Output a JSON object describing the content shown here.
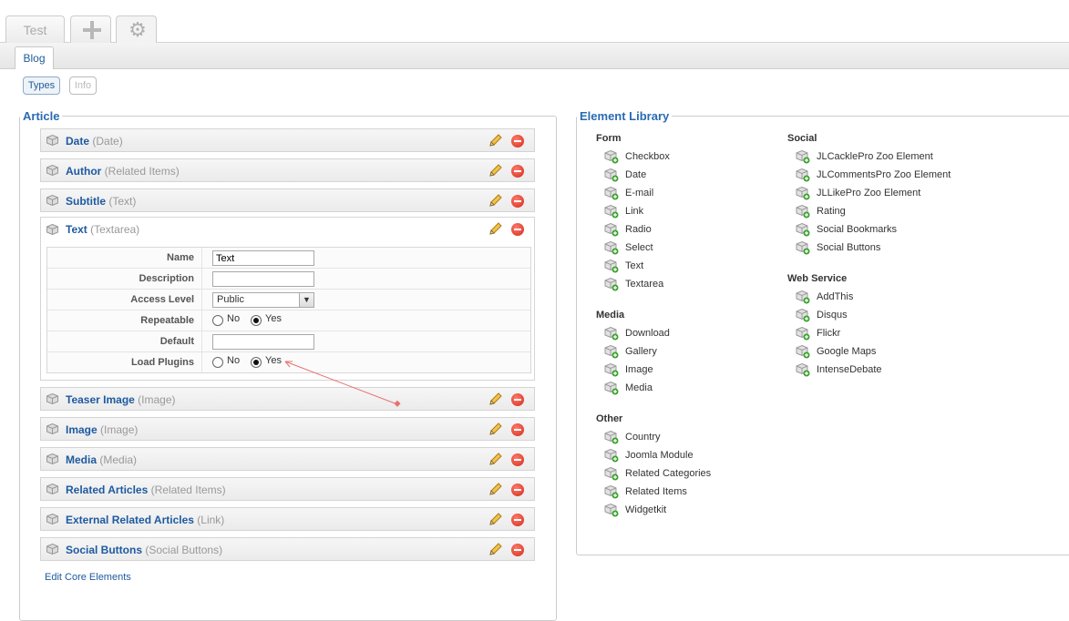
{
  "tabs": {
    "app_test": "Test",
    "sub_blog": "Blog"
  },
  "toolbar": {
    "types_label": "Types",
    "info_label": "Info"
  },
  "article": {
    "legend": "Article",
    "elements": [
      {
        "name": "Date",
        "type": "(Date)"
      },
      {
        "name": "Author",
        "type": "(Related Items)"
      },
      {
        "name": "Subtitle",
        "type": "(Text)"
      },
      {
        "name": "Text",
        "type": "(Textarea)"
      },
      {
        "name": "Teaser Image",
        "type": "(Image)"
      },
      {
        "name": "Image",
        "type": "(Image)"
      },
      {
        "name": "Media",
        "type": "(Media)"
      },
      {
        "name": "Related Articles",
        "type": "(Related Items)"
      },
      {
        "name": "External Related Articles",
        "type": "(Link)"
      },
      {
        "name": "Social Buttons",
        "type": "(Social Buttons)"
      }
    ],
    "config": {
      "name_label": "Name",
      "name_value": "Text",
      "description_label": "Description",
      "description_value": "",
      "access_label": "Access Level",
      "access_value": "Public",
      "repeatable_label": "Repeatable",
      "repeatable_no": "No",
      "repeatable_yes": "Yes",
      "default_label": "Default",
      "default_value": "",
      "load_plugins_label": "Load Plugins",
      "load_plugins_no": "No",
      "load_plugins_yes": "Yes"
    },
    "edit_core": "Edit Core Elements"
  },
  "library": {
    "legend": "Element Library",
    "groups": [
      {
        "title": "Form",
        "items": [
          "Checkbox",
          "Date",
          "E-mail",
          "Link",
          "Radio",
          "Select",
          "Text",
          "Textarea"
        ]
      },
      {
        "title": "Media",
        "items": [
          "Download",
          "Gallery",
          "Image",
          "Media"
        ]
      },
      {
        "title": "Other",
        "items": [
          "Country",
          "Joomla Module",
          "Related Categories",
          "Related Items",
          "Widgetkit"
        ]
      },
      {
        "title": "Social",
        "items": [
          "JLCacklePro Zoo Element",
          "JLCommentsPro Zoo Element",
          "JLLikePro Zoo Element",
          "Rating",
          "Social Bookmarks",
          "Social Buttons"
        ]
      },
      {
        "title": "Web Service",
        "items": [
          "AddThis",
          "Disqus",
          "Flickr",
          "Google Maps",
          "IntenseDebate"
        ]
      }
    ]
  },
  "icons": {
    "app_add": "plus-icon",
    "app_config": "gear-icon",
    "element": "cube-icon",
    "edit": "pencil-icon",
    "delete": "delete-icon",
    "library_item": "add-cube-icon"
  }
}
